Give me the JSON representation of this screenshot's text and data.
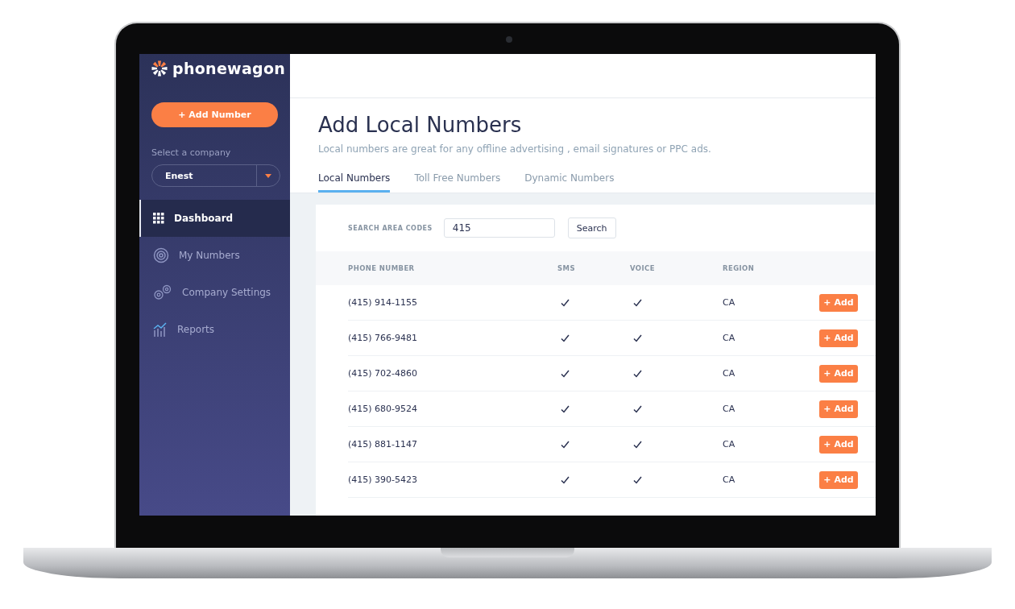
{
  "sidebar": {
    "brand": "phonewagon",
    "add_button": "+ Add Number",
    "company_label": "Select a company",
    "company": "Enest",
    "items": [
      {
        "label": "Dashboard",
        "kind": "grid",
        "selected": true
      },
      {
        "label": "My Numbers",
        "kind": "target",
        "selected": false
      },
      {
        "label": "Company Settings",
        "kind": "gears",
        "selected": false
      },
      {
        "label": "Reports",
        "kind": "chart",
        "selected": false
      }
    ]
  },
  "page": {
    "title": "Add Local Numbers",
    "subtitle": "Local numbers are great for any offline advertising , email signatures or PPC ads."
  },
  "tabs": [
    {
      "label": "Local Numbers",
      "selected": true
    },
    {
      "label": "Toll Free Numbers",
      "selected": false
    },
    {
      "label": "Dynamic Numbers",
      "selected": false
    }
  ],
  "search": {
    "label": "SEARCH AREA CODES",
    "value": "415",
    "button": "Search"
  },
  "table": {
    "columns": [
      "PHONE NUMBER",
      "SMS",
      "VOICE",
      "REGION"
    ],
    "rows": [
      {
        "phone": "(415) 914-1155",
        "sms": true,
        "voice": true,
        "region": "CA",
        "action": "+ Add"
      },
      {
        "phone": "(415) 766-9481",
        "sms": true,
        "voice": true,
        "region": "CA",
        "action": "+ Add"
      },
      {
        "phone": "(415) 702-4860",
        "sms": true,
        "voice": true,
        "region": "CA",
        "action": "+ Add"
      },
      {
        "phone": "(415) 680-9524",
        "sms": true,
        "voice": true,
        "region": "CA",
        "action": "+ Add"
      },
      {
        "phone": "(415) 881-1147",
        "sms": true,
        "voice": true,
        "region": "CA",
        "action": "+ Add"
      },
      {
        "phone": "(415) 390-5423",
        "sms": true,
        "voice": true,
        "region": "CA",
        "action": "+ Add"
      }
    ]
  }
}
